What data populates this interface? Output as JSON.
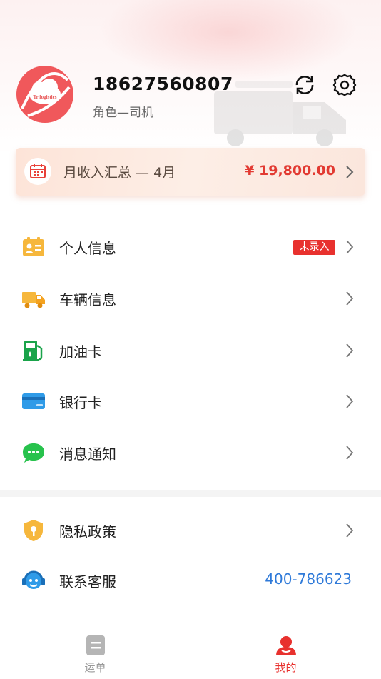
{
  "header": {
    "phone": "18627560807",
    "role": "角色—司机",
    "avatar_text": "Trilogistics",
    "refresh_icon": "refresh-icon",
    "settings_icon": "gear-icon"
  },
  "income": {
    "label": "月收入汇总 — 4月",
    "amount": "¥ 19,800.00"
  },
  "menu": [
    {
      "label": "个人信息",
      "badge": "未录入",
      "icon": "id-card-icon"
    },
    {
      "label": "车辆信息",
      "icon": "truck-icon"
    },
    {
      "label": "加油卡",
      "icon": "fuel-pump-icon"
    },
    {
      "label": "银行卡",
      "icon": "bank-card-icon"
    },
    {
      "label": "消息通知",
      "icon": "chat-bubble-icon"
    }
  ],
  "menu2": [
    {
      "label": "隐私政策",
      "icon": "shield-icon"
    },
    {
      "label": "联系客服",
      "value": "400-786623",
      "icon": "headset-icon"
    }
  ],
  "tabbar": [
    {
      "label": "运单",
      "active": false
    },
    {
      "label": "我的",
      "active": true
    }
  ],
  "colors": {
    "accent": "#e8312e",
    "link": "#2f7ad9",
    "inactive": "#999999"
  }
}
